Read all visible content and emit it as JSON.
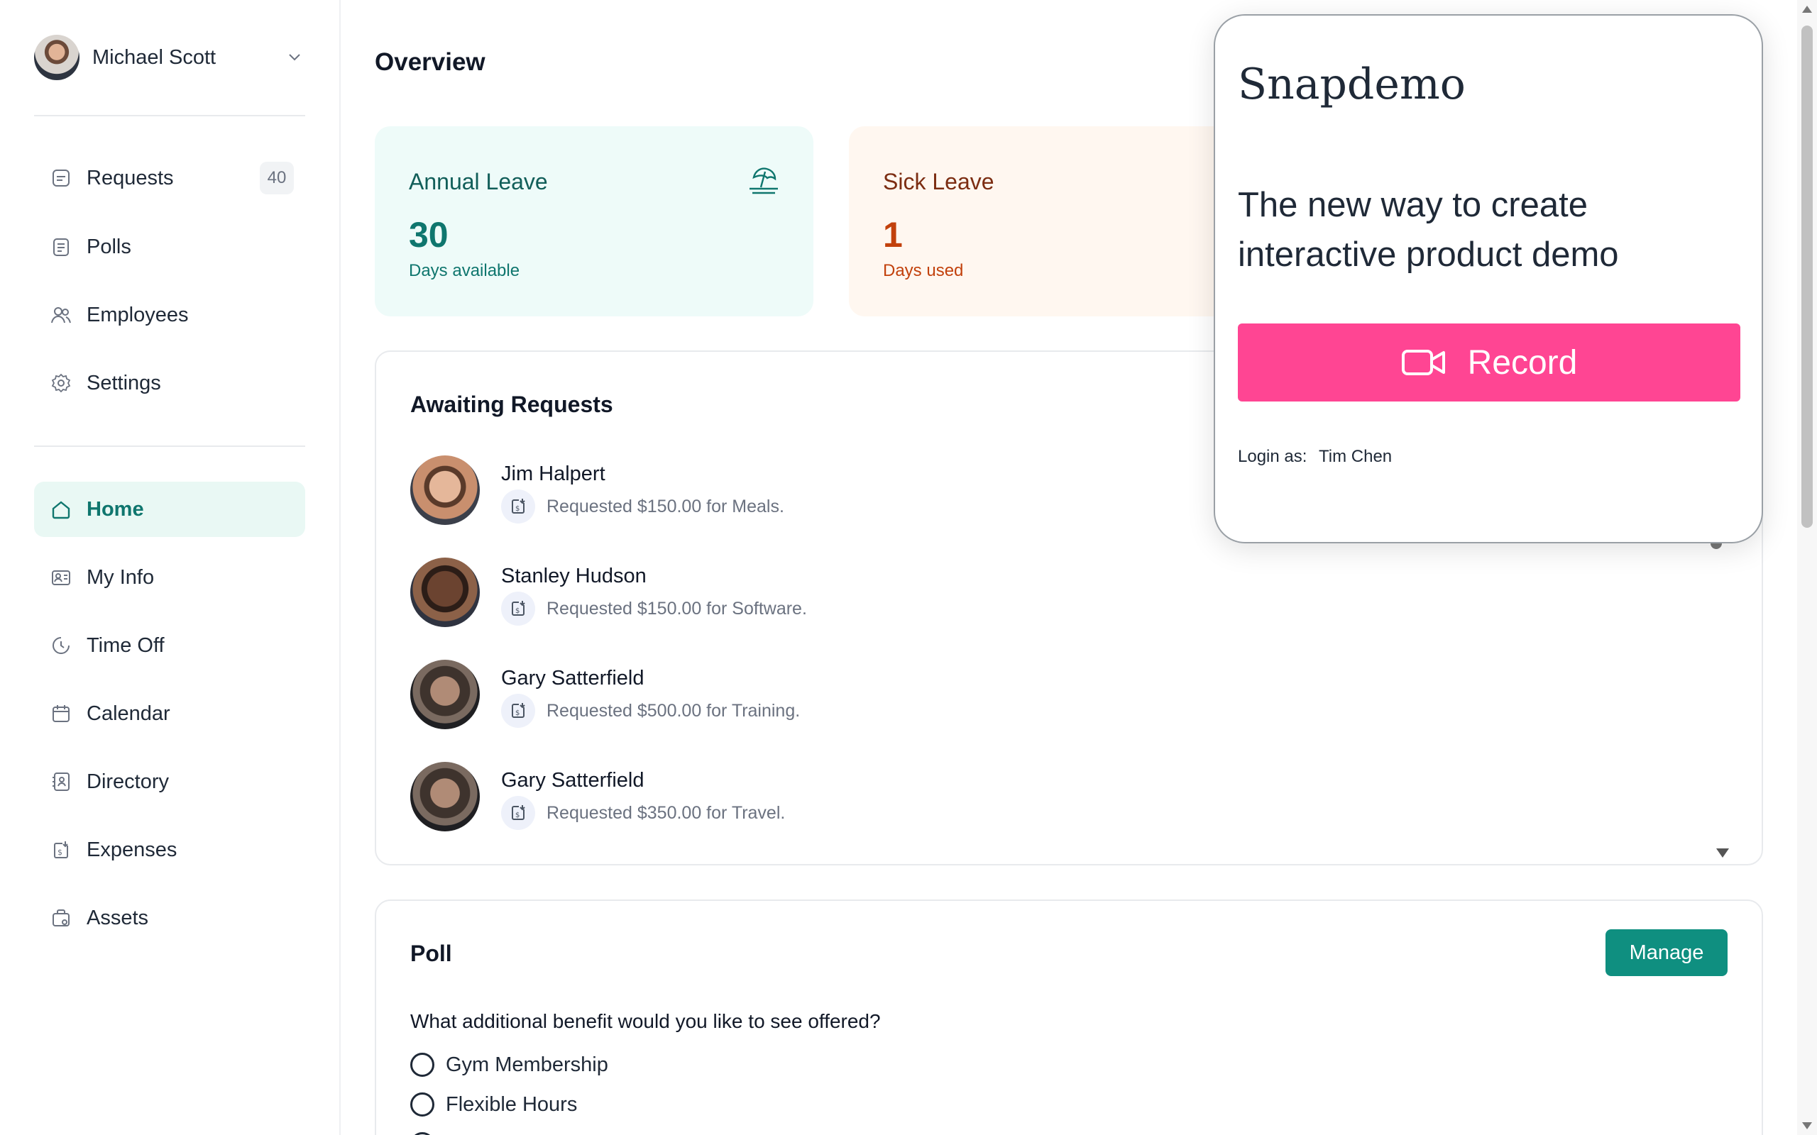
{
  "user": {
    "name": "Michael Scott"
  },
  "sidebar": {
    "top_items": [
      {
        "label": "Requests",
        "icon": "requests-icon",
        "badge": "40"
      },
      {
        "label": "Polls",
        "icon": "polls-icon"
      },
      {
        "label": "Employees",
        "icon": "employees-icon"
      },
      {
        "label": "Settings",
        "icon": "settings-icon"
      }
    ],
    "items": [
      {
        "label": "Home",
        "icon": "home-icon",
        "active": true
      },
      {
        "label": "My Info",
        "icon": "id-card-icon"
      },
      {
        "label": "Time Off",
        "icon": "clock-icon"
      },
      {
        "label": "Calendar",
        "icon": "calendar-icon"
      },
      {
        "label": "Directory",
        "icon": "directory-icon"
      },
      {
        "label": "Expenses",
        "icon": "expenses-icon"
      },
      {
        "label": "Assets",
        "icon": "assets-icon"
      }
    ]
  },
  "main": {
    "title": "Overview",
    "cards": {
      "annual": {
        "title": "Annual Leave",
        "value": "30",
        "sub": "Days available",
        "icon": "beach-umbrella-icon"
      },
      "sick": {
        "title": "Sick Leave",
        "value": "1",
        "sub": "Days used"
      }
    },
    "awaiting": {
      "title": "Awaiting Requests",
      "rows": [
        {
          "name": "Jim Halpert",
          "text": "Requested $150.00 for Meals."
        },
        {
          "name": "Stanley Hudson",
          "text": "Requested $150.00 for Software."
        },
        {
          "name": "Gary Satterfield",
          "text": "Requested $500.00 for Training."
        },
        {
          "name": "Gary Satterfield",
          "text": "Requested $350.00 for Travel."
        }
      ]
    },
    "poll": {
      "title": "Poll",
      "manage_label": "Manage",
      "question": "What additional benefit would you like to see offered?",
      "options": [
        "Gym Membership",
        "Flexible Hours"
      ]
    }
  },
  "popup": {
    "logo": "Snapdemo",
    "tagline": "The new way to create interactive product demo",
    "record_label": "Record",
    "login_label": "Login as:",
    "login_name": "Tim Chen"
  },
  "colors": {
    "accent": "#0f8f80",
    "record": "#ff4593",
    "annual_bg": "#eefbf9",
    "sick_bg": "#fff7f0"
  }
}
